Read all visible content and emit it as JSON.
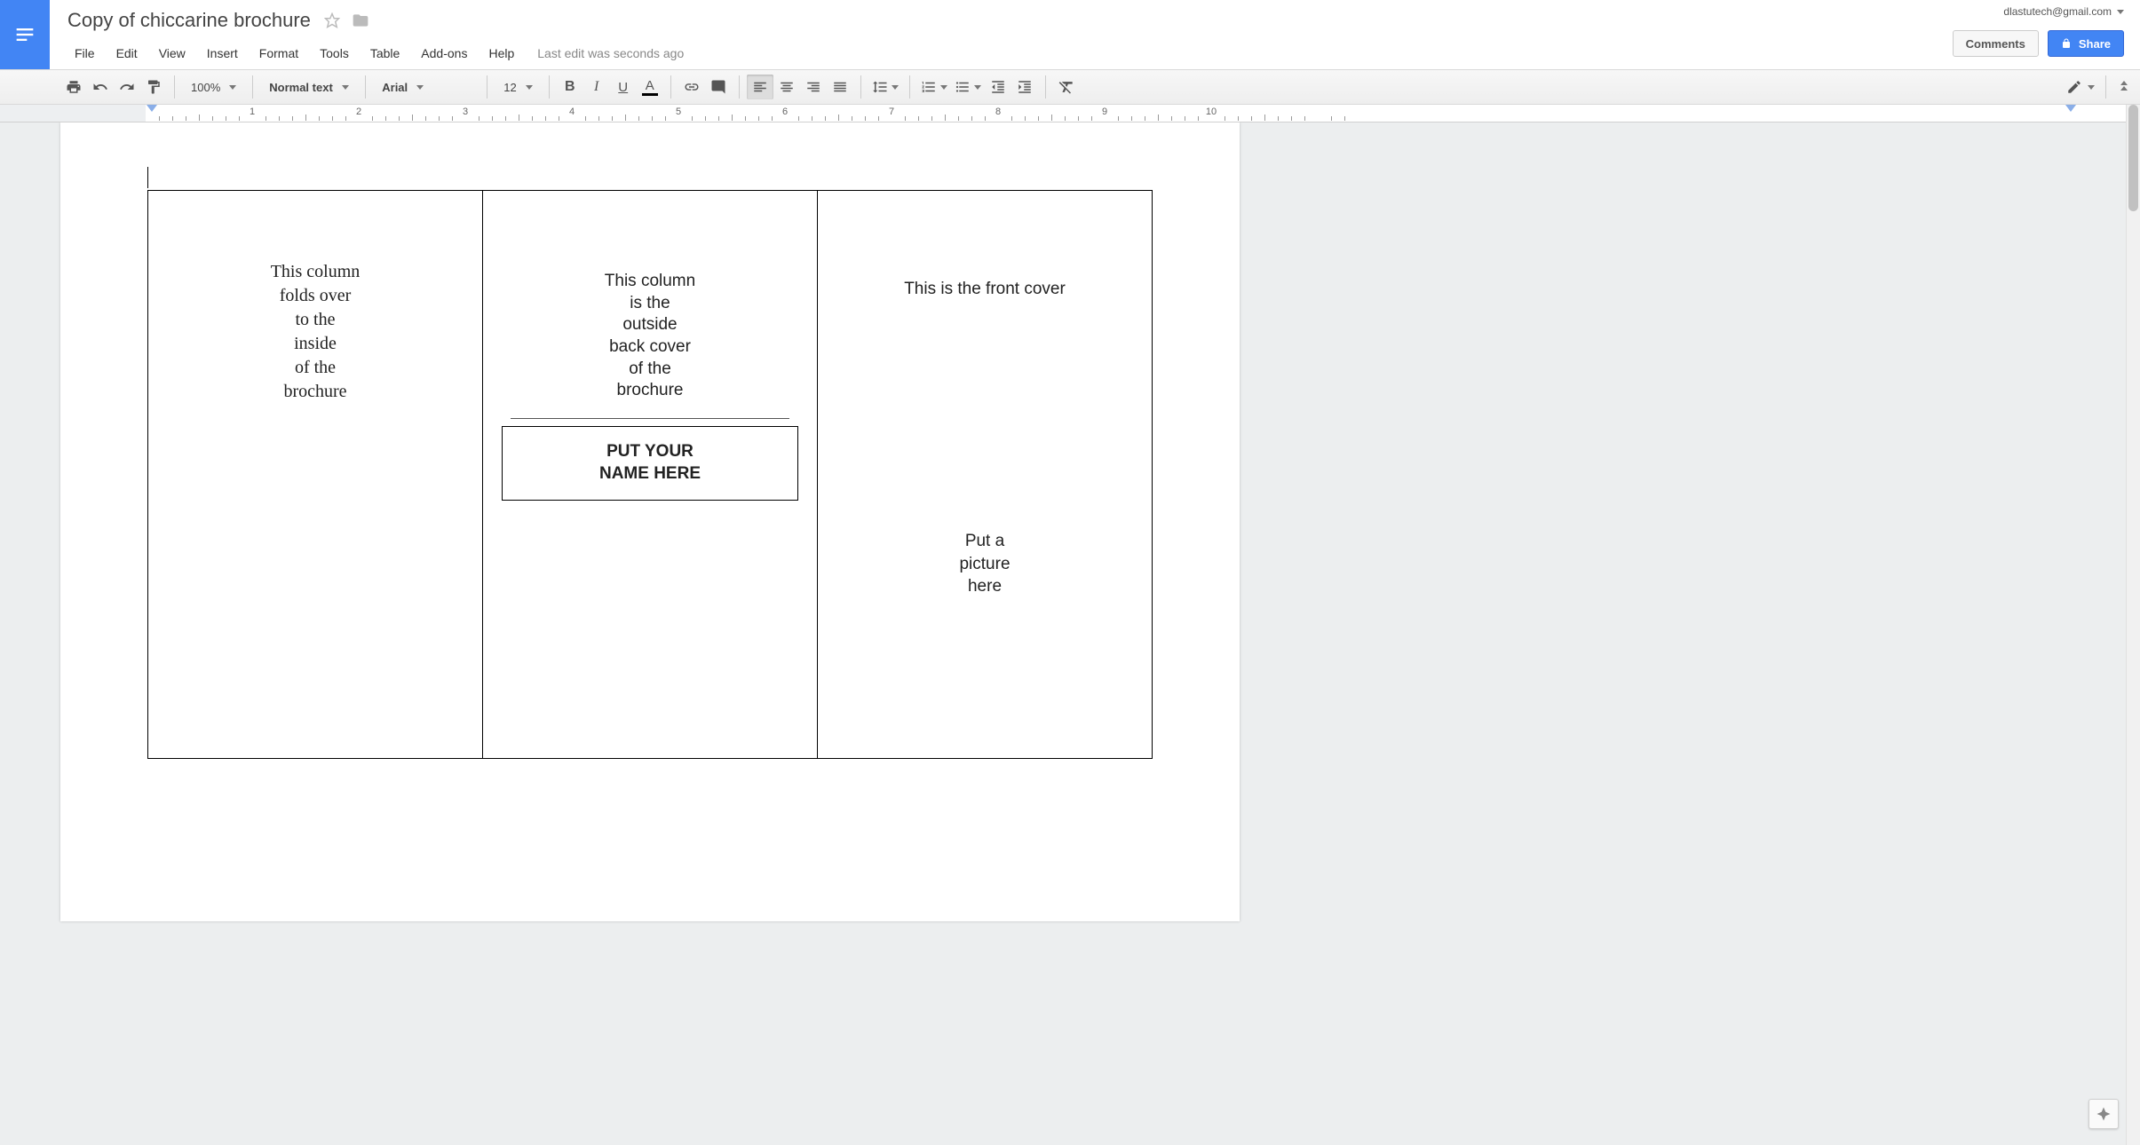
{
  "header": {
    "doc_title": "Copy of chiccarine brochure",
    "account_email": "dlastutech@gmail.com",
    "comments_btn": "Comments",
    "share_btn": "Share",
    "last_edit": "Last edit was seconds ago"
  },
  "menu": {
    "items": [
      "File",
      "Edit",
      "View",
      "Insert",
      "Format",
      "Tools",
      "Table",
      "Add-ons",
      "Help"
    ]
  },
  "toolbar": {
    "zoom": "100%",
    "styles": "Normal text",
    "font": "Arial",
    "font_size": "12"
  },
  "ruler": {
    "marks": [
      1,
      2,
      3,
      4,
      5,
      6,
      7,
      8,
      9,
      10
    ]
  },
  "document": {
    "col1": {
      "l1": "This column",
      "l2": "folds over",
      "l3": "to the",
      "l4": "inside",
      "l5": "of the",
      "l6": "brochure"
    },
    "col2": {
      "l1": "This column",
      "l2": "is the",
      "l3": "outside",
      "l4": "back cover",
      "l5": "of the",
      "l6": "brochure",
      "name1": "PUT YOUR",
      "name2": "NAME HERE"
    },
    "col3": {
      "title": "This is the front cover",
      "pic1": "Put a",
      "pic2": "picture",
      "pic3": "here"
    }
  }
}
